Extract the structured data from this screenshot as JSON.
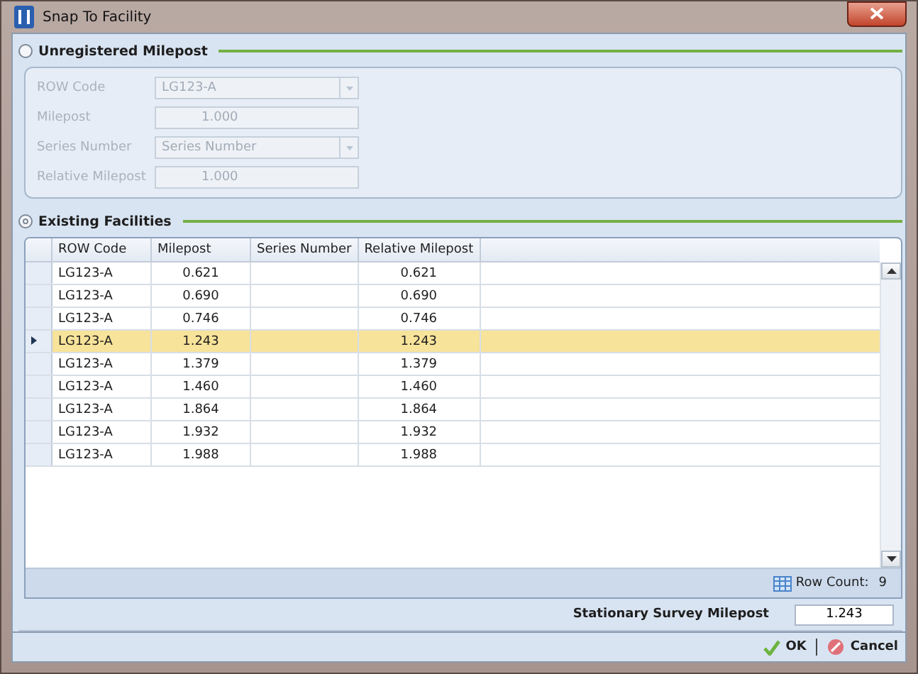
{
  "window": {
    "title": "Snap To Facility"
  },
  "unregistered": {
    "label": "Unregistered Milepost",
    "selected": false,
    "fields": [
      {
        "label": "ROW Code",
        "kind": "combo",
        "value": "LG123-A"
      },
      {
        "label": "Milepost",
        "kind": "text",
        "value": "1.000"
      },
      {
        "label": "Series Number",
        "kind": "combo",
        "placeholder": "Series Number"
      },
      {
        "label": "Relative Milepost",
        "kind": "text",
        "value": "1.000"
      }
    ]
  },
  "existing": {
    "label": "Existing Facilities",
    "selected": true,
    "table": {
      "columns": [
        "ROW Code",
        "Milepost",
        "Series Number",
        "Relative Milepost"
      ],
      "rows": [
        {
          "row_code": "LG123-A",
          "milepost": "0.621",
          "series_number": "",
          "relative_milepost": "0.621",
          "selected": false
        },
        {
          "row_code": "LG123-A",
          "milepost": "0.690",
          "series_number": "",
          "relative_milepost": "0.690",
          "selected": false
        },
        {
          "row_code": "LG123-A",
          "milepost": "0.746",
          "series_number": "",
          "relative_milepost": "0.746",
          "selected": false
        },
        {
          "row_code": "LG123-A",
          "milepost": "1.243",
          "series_number": "",
          "relative_milepost": "1.243",
          "selected": true
        },
        {
          "row_code": "LG123-A",
          "milepost": "1.379",
          "series_number": "",
          "relative_milepost": "1.379",
          "selected": false
        },
        {
          "row_code": "LG123-A",
          "milepost": "1.460",
          "series_number": "",
          "relative_milepost": "1.460",
          "selected": false
        },
        {
          "row_code": "LG123-A",
          "milepost": "1.864",
          "series_number": "",
          "relative_milepost": "1.864",
          "selected": false
        },
        {
          "row_code": "LG123-A",
          "milepost": "1.932",
          "series_number": "",
          "relative_milepost": "1.932",
          "selected": false
        },
        {
          "row_code": "LG123-A",
          "milepost": "1.988",
          "series_number": "",
          "relative_milepost": "1.988",
          "selected": false
        }
      ]
    },
    "row_count_label": "Row Count:",
    "row_count": "9"
  },
  "stationary": {
    "label": "Stationary Survey Milepost",
    "value": "1.243"
  },
  "buttons": [
    {
      "kind": "ok",
      "label": "OK"
    },
    {
      "kind": "cancel",
      "label": "Cancel"
    }
  ]
}
